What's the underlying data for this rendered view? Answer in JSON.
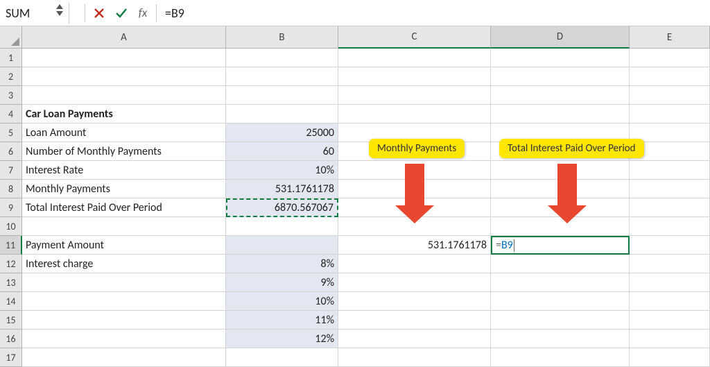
{
  "namebox": "SUM",
  "formula_bar": "=B9",
  "fx_label": "fx",
  "col_headers": [
    "A",
    "B",
    "C",
    "D",
    "E"
  ],
  "rows": [
    "1",
    "2",
    "3",
    "4",
    "5",
    "6",
    "7",
    "8",
    "9",
    "10",
    "11",
    "12",
    "13",
    "14",
    "15",
    "16",
    "17"
  ],
  "a4": "Car Loan Payments",
  "a5": "Loan Amount",
  "b5": "25000",
  "a6": "Number of Monthly Payments",
  "b6": "60",
  "a7": "Interest Rate",
  "b7": "10%",
  "a8": "Monthly Payments",
  "b8": "531.1761178",
  "a9": "Total Interest Paid Over Period",
  "b9": "6870.567067",
  "a11": "Payment Amount",
  "c11": "531.1761178",
  "d11_prefix": "=",
  "d11_ref": "B9",
  "a12": "Interest charge",
  "b12": "8%",
  "b13": "9%",
  "b14": "10%",
  "b15": "11%",
  "b16": "12%",
  "call1": "Monthly Payments",
  "call2": "Total Interest Paid Over Period"
}
